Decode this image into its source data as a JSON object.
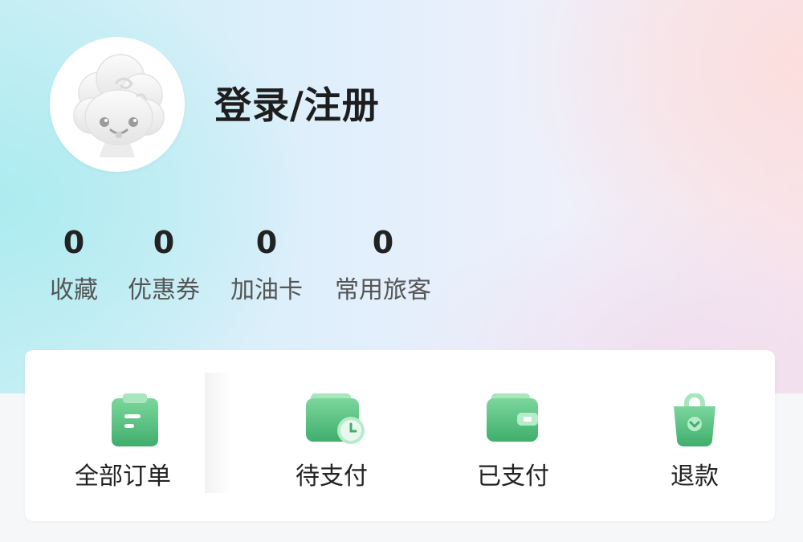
{
  "profile": {
    "login_label": "登录/注册",
    "avatar_icon": "cloud-mascot-icon"
  },
  "stats": [
    {
      "value": "0",
      "label": "收藏"
    },
    {
      "value": "0",
      "label": "优惠券"
    },
    {
      "value": "0",
      "label": "加油卡"
    },
    {
      "value": "0",
      "label": "常用旅客"
    }
  ],
  "orders": [
    {
      "label": "全部订单",
      "icon": "clipboard-icon"
    },
    {
      "label": "待支付",
      "icon": "wallet-clock-icon"
    },
    {
      "label": "已支付",
      "icon": "wallet-icon"
    },
    {
      "label": "退款",
      "icon": "shopping-bag-icon"
    }
  ],
  "colors": {
    "accent_green": "#5cc486",
    "accent_green_dark": "#3fae6c",
    "text_primary": "#1e1e1e",
    "text_secondary": "#555555"
  }
}
